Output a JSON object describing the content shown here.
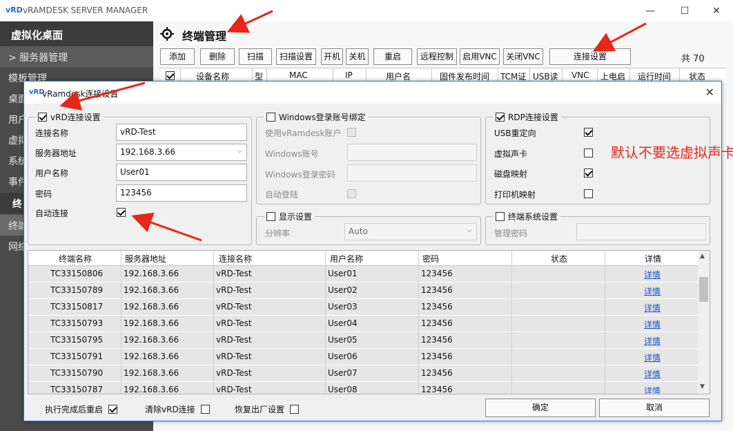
{
  "window": {
    "logo": "vRD",
    "title": "vRAMDESK SERVER MANAGER",
    "minimize": "—",
    "maximize": "☐",
    "close": "✕"
  },
  "sidebar": {
    "header": "虚拟化桌面",
    "items": [
      {
        "label": "> 服务器管理"
      },
      {
        "label": "模板管理"
      },
      {
        "label": "桌面"
      },
      {
        "label": "用户"
      },
      {
        "label": "虚拟"
      },
      {
        "label": "系统"
      },
      {
        "label": "事件"
      },
      {
        "label": "终"
      },
      {
        "label": "终端"
      },
      {
        "label": "网络"
      }
    ]
  },
  "main": {
    "title": "终端管理",
    "toolbar": [
      "添加",
      "删除",
      "扫描",
      "扫描设置",
      "开机",
      "关机",
      "重启",
      "远程控制",
      "启用VNC",
      "关闭VNC",
      "连接设置"
    ],
    "total": "共  70",
    "grid_headers": [
      "设备名称",
      "型",
      "MAC",
      "IP",
      "用户名",
      "固件发布时间",
      "TCM证",
      "USB读",
      "VNC",
      "上电启",
      "运行时间",
      "状态"
    ]
  },
  "dialog": {
    "logo": "vRD",
    "title": "vRamdesk连接设置",
    "close": "✕",
    "vrd_group": {
      "legend": "vRD连接设置",
      "checked": true,
      "conn_name_label": "连接名称",
      "conn_name_value": "vRD-Test",
      "server_label": "服务器地址",
      "server_value": "192.168.3.66",
      "user_label": "用户名称",
      "user_value": "User01",
      "password_label": "密码",
      "password_value": "123456",
      "auto_connect_label": "自动连接",
      "auto_connect_checked": true
    },
    "windows_group": {
      "legend": "Windows登录账号绑定",
      "checked": false,
      "use_account_label": "使用vRamdesk账户",
      "account_label": "Windows账号",
      "password_label": "Windows登录密码",
      "auto_login_label": "自动登陆"
    },
    "rdp_group": {
      "legend": "RDP连接设置",
      "checked": true,
      "usb_label": "USB重定向",
      "usb_checked": true,
      "sound_label": "虚拟声卡",
      "sound_checked": false,
      "disk_label": "磁盘映射",
      "disk_checked": true,
      "printer_label": "打印机映射",
      "printer_checked": false
    },
    "display_group": {
      "legend": "显示设置",
      "resolution_label": "分辨率",
      "resolution_value": "Auto"
    },
    "terminal_group": {
      "legend": "终端系统设置",
      "admin_pwd_label": "管理密码"
    },
    "annotation": "默认不要选虚拟声卡",
    "table": {
      "headers": [
        "终端名称",
        "服务器地址",
        "连接名称",
        "用户名称",
        "密码",
        "状态",
        "详情"
      ],
      "rows": [
        [
          "TC33150806",
          "192.168.3.66",
          "vRD-Test",
          "User01",
          "123456",
          "",
          "详情"
        ],
        [
          "TC33150789",
          "192.168.3.66",
          "vRD-Test",
          "User02",
          "123456",
          "",
          "详情"
        ],
        [
          "TC33150817",
          "192.168.3.66",
          "vRD-Test",
          "User03",
          "123456",
          "",
          "详情"
        ],
        [
          "TC33150793",
          "192.168.3.66",
          "vRD-Test",
          "User04",
          "123456",
          "",
          "详情"
        ],
        [
          "TC33150795",
          "192.168.3.66",
          "vRD-Test",
          "User05",
          "123456",
          "",
          "详情"
        ],
        [
          "TC33150791",
          "192.168.3.66",
          "vRD-Test",
          "User06",
          "123456",
          "",
          "详情"
        ],
        [
          "TC33150790",
          "192.168.3.66",
          "vRD-Test",
          "User07",
          "123456",
          "",
          "详情"
        ],
        [
          "TC33150787",
          "192.168.3.66",
          "vRD-Test",
          "User08",
          "123456",
          "",
          "详情"
        ]
      ]
    },
    "bottom": {
      "reboot_label": "执行完成后重启",
      "reboot_checked": true,
      "clear_label": "清除vRD连接",
      "clear_checked": false,
      "factory_label": "恢复出厂设置",
      "factory_checked": false,
      "ok_label": "确定",
      "cancel_label": "取消"
    },
    "scroll_up": "▲",
    "scroll_down": "▼"
  },
  "colors": {
    "annotation": "#e8261a",
    "arrow": "#e8261a",
    "link": "#1a4fd6",
    "dialog_border": "#2b79c7"
  }
}
